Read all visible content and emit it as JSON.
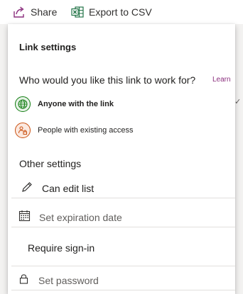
{
  "toolbar": {
    "share_label": "Share",
    "export_label": "Export to CSV",
    "share_icon": "share-icon",
    "export_icon": "excel-icon"
  },
  "panel": {
    "title": "Link settings",
    "question": "Who would you like this link to work for?",
    "learn_link": "Learn",
    "options": [
      {
        "label": "Anyone with the link",
        "icon": "globe-icon",
        "selected": true
      },
      {
        "label": "People with existing access",
        "icon": "people-lock-icon",
        "selected": false
      }
    ],
    "other_settings_title": "Other settings",
    "can_edit_label": "Can edit list",
    "expiration_placeholder": "Set expiration date",
    "require_signin_label": "Require sign-in",
    "password_placeholder": "Set password"
  },
  "colors": {
    "learn_link": "#8b2f7e",
    "globe": "#107c10",
    "people": "#ca5010",
    "excel": "#217346",
    "share_icon": "#8b2f7e"
  }
}
